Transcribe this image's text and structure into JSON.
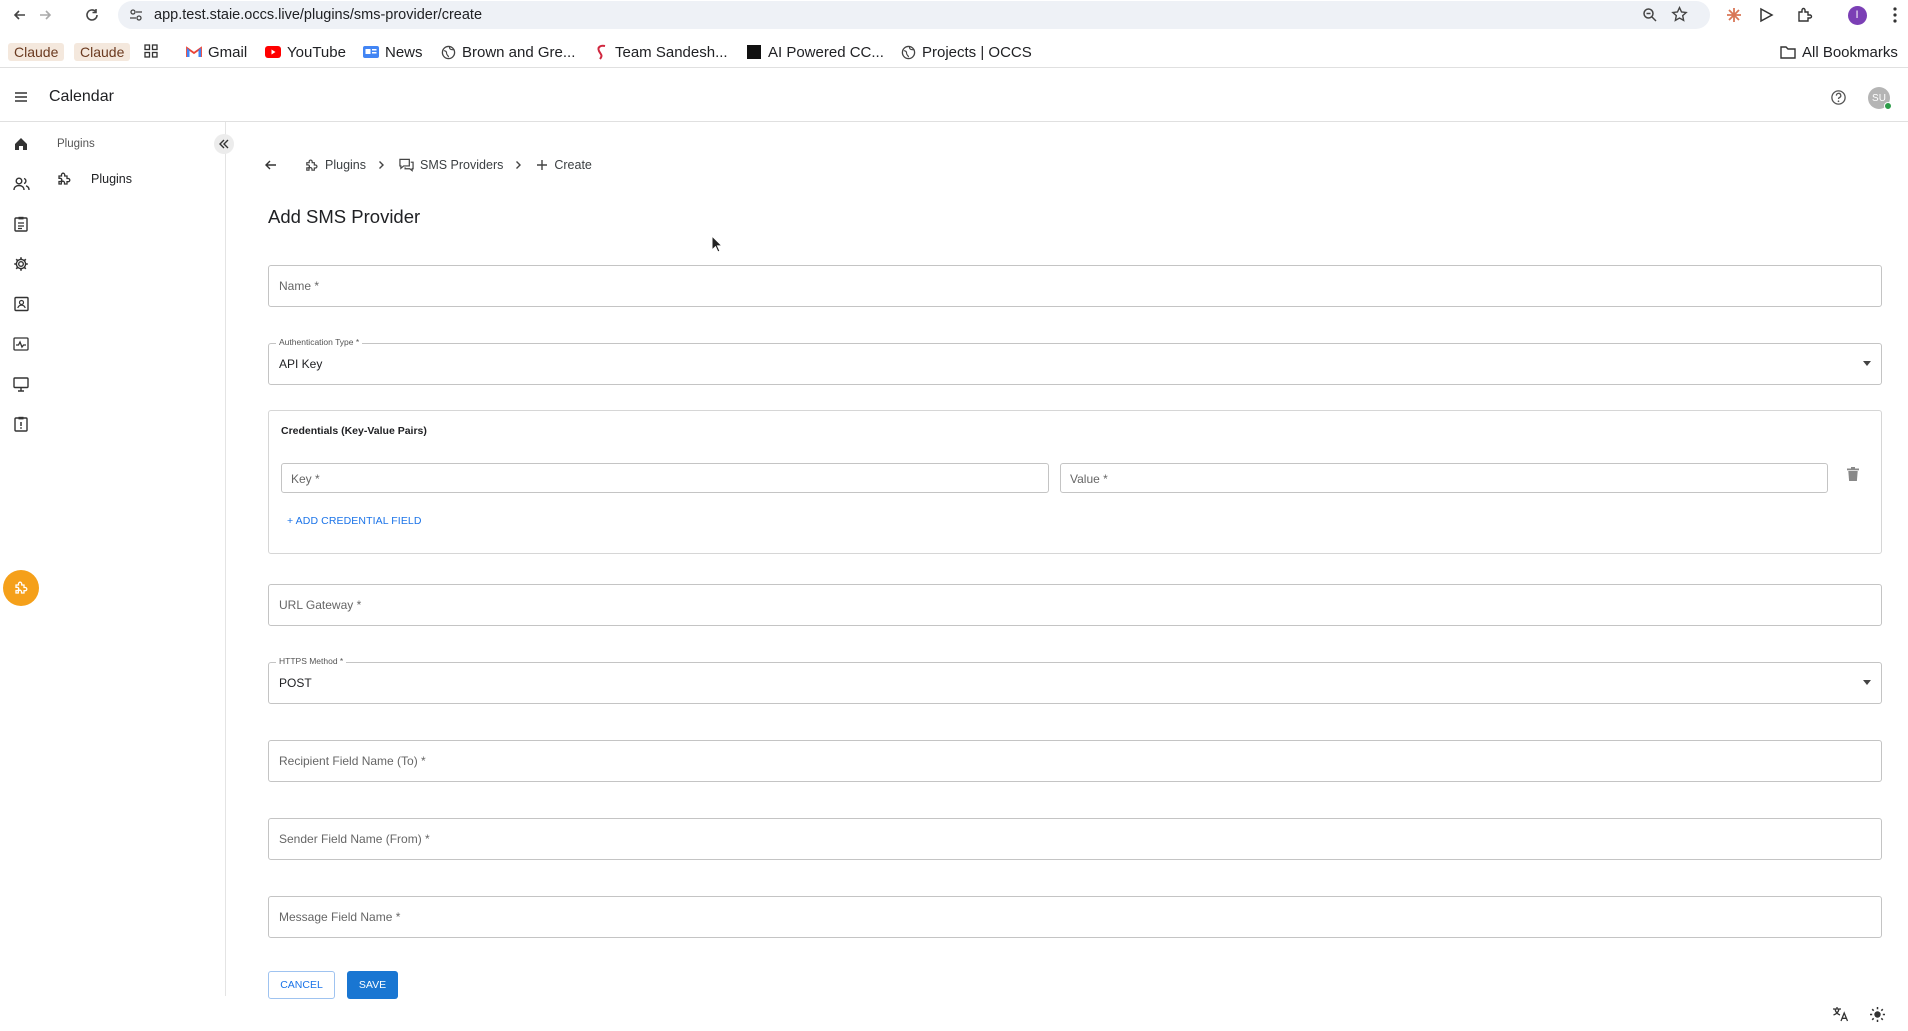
{
  "browser": {
    "url": "app.test.staie.occs.live/plugins/sms-provider/create",
    "profile_initial": "I",
    "bookmarks": [
      {
        "label": "Claude",
        "icon": "claude-chip"
      },
      {
        "label": "Claude",
        "icon": "claude-chip"
      },
      {
        "label": "Gmail",
        "icon": "gmail-icon"
      },
      {
        "label": "YouTube",
        "icon": "youtube-icon"
      },
      {
        "label": "News",
        "icon": "google-news-icon"
      },
      {
        "label": "Brown and Gre...",
        "icon": "globe-icon"
      },
      {
        "label": "Team Sandesh...",
        "icon": "sandesh-icon"
      },
      {
        "label": "AI Powered CC...",
        "icon": "black-square-icon"
      },
      {
        "label": "Projects | OCCS",
        "icon": "globe-icon"
      }
    ],
    "all_bookmarks": "All Bookmarks"
  },
  "header": {
    "title": "Calendar",
    "avatar_initials": "SU"
  },
  "rail": {
    "icons": [
      "home-icon",
      "users-icon",
      "clipboard-icon",
      "gear-icon",
      "contact-book-icon",
      "activity-icon",
      "monitor-icon",
      "report-icon",
      "plugin-icon"
    ],
    "active": "plugin-icon",
    "active_color": "#f5a01a"
  },
  "subnav": {
    "section": "Plugins",
    "items": [
      {
        "label": "Plugins",
        "icon": "plugin-icon"
      }
    ]
  },
  "breadcrumb": {
    "items": [
      {
        "label": "Plugins",
        "icon": "plugin-icon"
      },
      {
        "label": "SMS Providers",
        "icon": "chat-icon"
      },
      {
        "label": "Create",
        "icon": "plus-icon"
      }
    ]
  },
  "form": {
    "title": "Add SMS Provider",
    "name_placeholder": "Name *",
    "auth_type": {
      "label": "Authentication Type *",
      "value": "API Key"
    },
    "credentials": {
      "title": "Credentials (Key-Value Pairs)",
      "key_placeholder": "Key *",
      "value_placeholder": "Value *",
      "add_label": "+ ADD CREDENTIAL FIELD"
    },
    "url_gateway_placeholder": "URL Gateway *",
    "https_method": {
      "label": "HTTPS Method *",
      "value": "POST"
    },
    "recipient_placeholder": "Recipient Field Name (To) *",
    "sender_placeholder": "Sender Field Name (From) *",
    "message_placeholder": "Message Field Name *",
    "cancel_label": "CANCEL",
    "save_label": "SAVE"
  },
  "colors": {
    "primary": "#1976d2",
    "accent": "#f5a01a"
  }
}
